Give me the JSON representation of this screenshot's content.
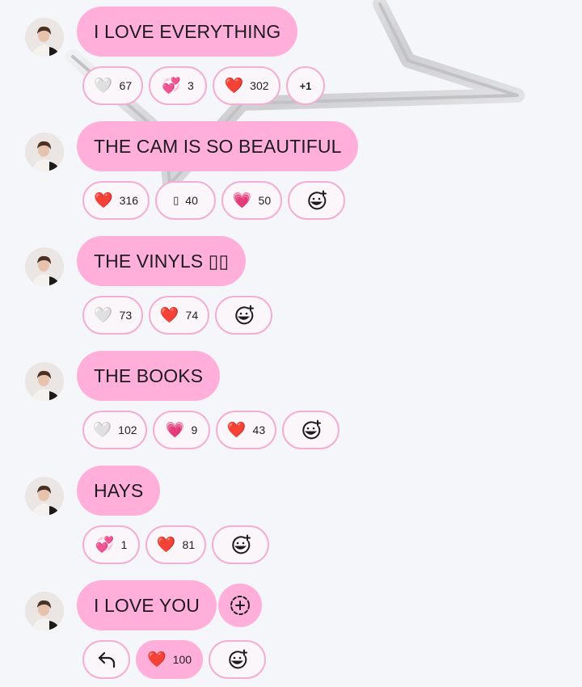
{
  "theme": {
    "bubble_color": "#ffafda",
    "chip_border": "#f3aed3",
    "background": "#f5f6fa"
  },
  "messages": [
    {
      "text": "I LOVE EVERYTHING",
      "reactions": [
        {
          "icon": "white-heart-icon",
          "emoji": "🤍",
          "count": "67"
        },
        {
          "icon": "two-hearts-icon",
          "emoji": "💞",
          "count": "3"
        },
        {
          "icon": "red-heart-icon",
          "emoji": "❤️",
          "count": "302"
        },
        {
          "icon": "more-reactions",
          "label": "+1"
        }
      ]
    },
    {
      "text": "THE CAM IS SO BEAUTIFUL",
      "reactions": [
        {
          "icon": "red-heart-icon",
          "emoji": "❤️",
          "count": "316"
        },
        {
          "icon": "unknown-emoji-icon",
          "emoji": "▯",
          "count": "40"
        },
        {
          "icon": "sparkling-heart-icon",
          "emoji": "💗",
          "count": "50"
        },
        {
          "icon": "add-reaction-icon"
        }
      ]
    },
    {
      "text": "THE VINYLS ▯▯",
      "reactions": [
        {
          "icon": "white-heart-icon",
          "emoji": "🤍",
          "count": "73"
        },
        {
          "icon": "red-heart-icon",
          "emoji": "❤️",
          "count": "74"
        },
        {
          "icon": "add-reaction-icon"
        }
      ]
    },
    {
      "text": "THE BOOKS",
      "reactions": [
        {
          "icon": "white-heart-icon",
          "emoji": "🤍",
          "count": "102"
        },
        {
          "icon": "sparkling-heart-icon",
          "emoji": "💗",
          "count": "9"
        },
        {
          "icon": "red-heart-icon",
          "emoji": "❤️",
          "count": "43"
        },
        {
          "icon": "add-reaction-icon"
        }
      ]
    },
    {
      "text": "HAYS",
      "reactions": [
        {
          "icon": "two-hearts-icon",
          "emoji": "💞",
          "count": "1"
        },
        {
          "icon": "red-heart-icon",
          "emoji": "❤️",
          "count": "81"
        },
        {
          "icon": "add-reaction-icon"
        }
      ]
    },
    {
      "text": "I LOVE YOU",
      "side_action": "add-reaction-circle-icon",
      "reactions": [
        {
          "icon": "reply-icon"
        },
        {
          "icon": "red-heart-icon",
          "emoji": "❤️",
          "count": "100",
          "selected": true
        },
        {
          "icon": "add-reaction-icon"
        }
      ]
    }
  ]
}
